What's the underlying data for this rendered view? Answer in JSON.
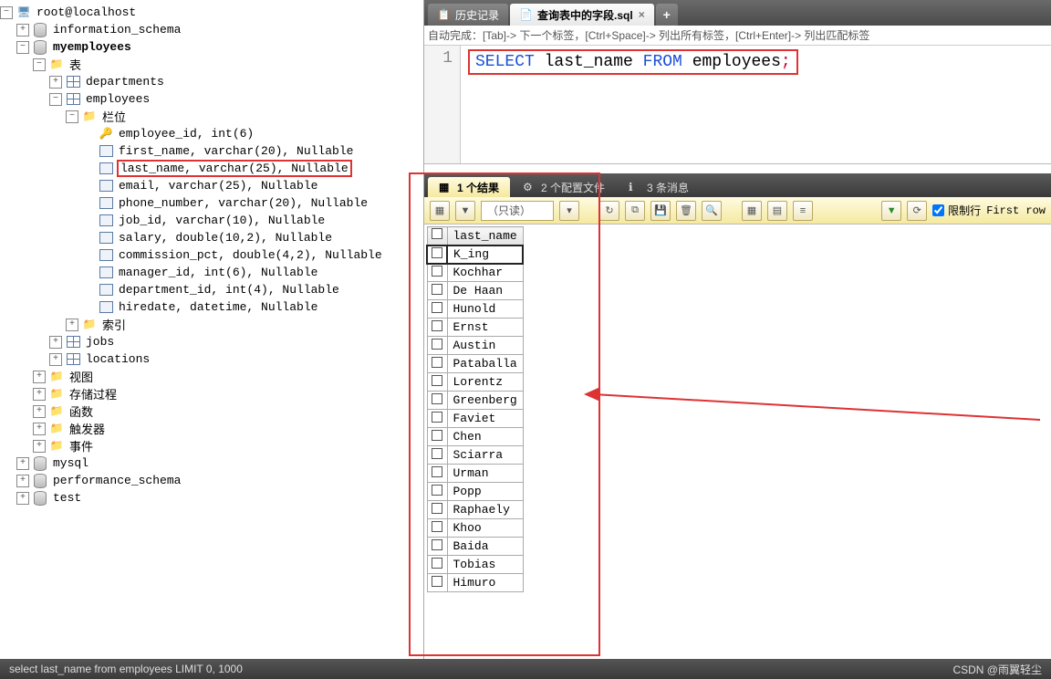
{
  "tree": {
    "root": "root@localhost",
    "dbs": [
      "information_schema",
      "myemployees",
      "mysql",
      "performance_schema",
      "test"
    ],
    "myemp": {
      "table_folder": "表",
      "tables": [
        "departments",
        "employees",
        "jobs",
        "locations"
      ],
      "emp_cols_folder": "栏位",
      "emp_cols": [
        "employee_id, int(6)",
        "first_name, varchar(20), Nullable",
        "last_name, varchar(25), Nullable",
        "email, varchar(25), Nullable",
        "phone_number, varchar(20), Nullable",
        "job_id, varchar(10), Nullable",
        "salary, double(10,2), Nullable",
        "commission_pct, double(4,2), Nullable",
        "manager_id, int(6), Nullable",
        "department_id, int(4), Nullable",
        "hiredate, datetime, Nullable"
      ],
      "idx_folder": "索引",
      "other_folders": [
        "视图",
        "存储过程",
        "函数",
        "触发器",
        "事件"
      ]
    }
  },
  "tabs": {
    "history": "历史记录",
    "active": "查询表中的字段.sql"
  },
  "hint": "自动完成：[Tab]-> 下一个标签，[Ctrl+Space]-> 列出所有标签，[Ctrl+Enter]-> 列出匹配标签",
  "sql": {
    "line_no": "1",
    "select": "SELECT",
    "col": "last_name",
    "from": "FROM",
    "tbl": "employees",
    "semi": ";"
  },
  "result_tabs": {
    "r1": "1 个结果",
    "r2": "2 个配置文件",
    "r3": "3 条消息"
  },
  "toolbar": {
    "readonly": "（只读）",
    "limit": "限制行",
    "firstrow": "First row"
  },
  "grid": {
    "header": "last_name",
    "rows": [
      "K_ing",
      "Kochhar",
      "De Haan",
      "Hunold",
      "Ernst",
      "Austin",
      "Pataballa",
      "Lorentz",
      "Greenberg",
      "Faviet",
      "Chen",
      "Sciarra",
      "Urman",
      "Popp",
      "Raphaely",
      "Khoo",
      "Baida",
      "Tobias",
      "Himuro"
    ]
  },
  "status": {
    "left": "select last_name from employees LIMIT 0, 1000",
    "right": "CSDN @雨翼轻尘"
  }
}
